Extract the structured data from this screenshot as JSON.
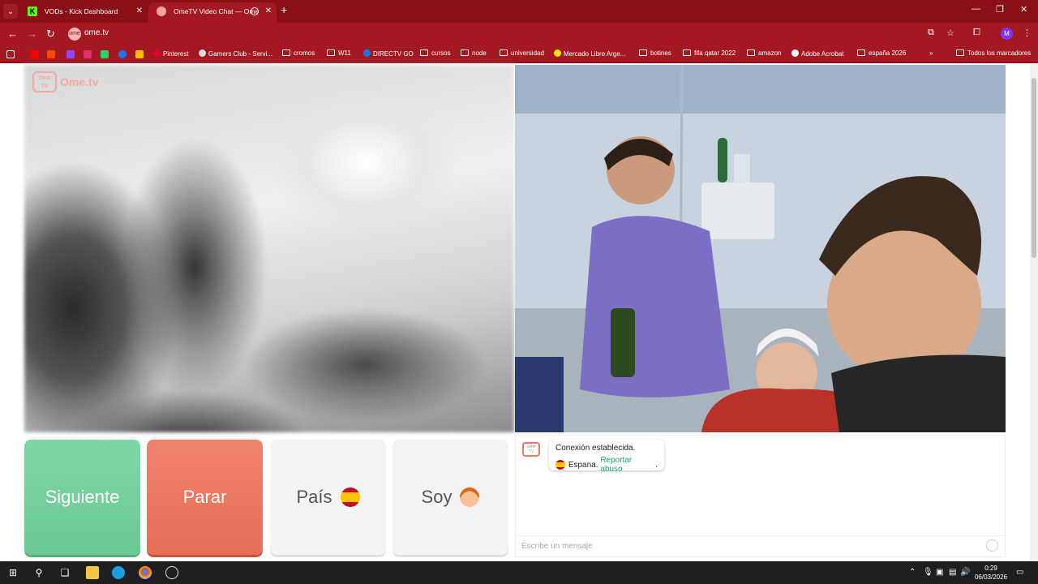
{
  "browser": {
    "tabs": [
      {
        "title": "VODs - Kick Dashboard",
        "active": false,
        "favicon": "kick-icon"
      },
      {
        "title": "OmeTV Video Chat — Ome",
        "active": true,
        "favicon": "ometv-icon"
      }
    ],
    "url": "ome.tv",
    "new_tab_symbol": "+",
    "close_symbol": "✕",
    "bookmarks": [
      {
        "label": "Pinterest",
        "type": "site"
      },
      {
        "label": "Gamers Club - Servi...",
        "type": "site"
      },
      {
        "label": "cromos",
        "type": "folder"
      },
      {
        "label": "W11",
        "type": "folder"
      },
      {
        "label": "DIRECTV GO",
        "type": "site"
      },
      {
        "label": "cursos",
        "type": "folder"
      },
      {
        "label": "node",
        "type": "folder"
      },
      {
        "label": "universidad",
        "type": "folder"
      },
      {
        "label": "Mercado Libre Arge...",
        "type": "site"
      },
      {
        "label": "botines",
        "type": "folder"
      },
      {
        "label": "fifa qatar 2022",
        "type": "folder"
      },
      {
        "label": "amazon",
        "type": "folder"
      },
      {
        "label": "Adobe Acrobat",
        "type": "site"
      },
      {
        "label": "españa 2026",
        "type": "folder"
      }
    ],
    "bookmarks_overflow": "»",
    "all_bookmarks": "Todos los marcadores",
    "profile_initial": "M",
    "theme_color": "#a41821"
  },
  "ometv": {
    "logo_box": "Ome TV",
    "logo_text": "Ome.tv",
    "buttons": {
      "next": "Siguiente",
      "stop": "Parar",
      "country": "País",
      "gender": "Soy"
    },
    "chat": {
      "status": "Conexión establecida.",
      "country": "Espana.",
      "report": "Reportar abuso",
      "report_suffix": ".",
      "placeholder": "Escribe un mensaje"
    },
    "colors": {
      "next": "#6bc995",
      "stop": "#e66e57",
      "accent": "#2aa06a"
    }
  },
  "taskbar": {
    "time": "0:29",
    "date": "06/03/2026"
  }
}
